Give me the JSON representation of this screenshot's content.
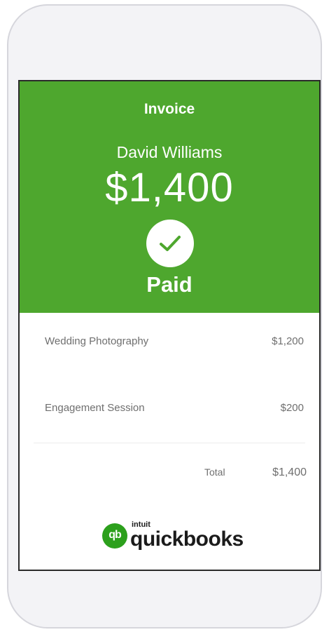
{
  "invoice": {
    "title": "Invoice",
    "customer_name": "David Williams",
    "amount": "$1,400",
    "status": "Paid",
    "header_color": "#4ea72e"
  },
  "line_items": [
    {
      "description": "Wedding Photography",
      "amount": "$1,200"
    },
    {
      "description": "Engagement Session",
      "amount": "$200"
    }
  ],
  "total": {
    "label": "Total",
    "amount": "$1,400"
  },
  "brand": {
    "mark": "qb",
    "intuit": "intuit",
    "name": "quickbooks",
    "color": "#2ca01c"
  },
  "icons": {
    "status": "checkmark-icon"
  }
}
